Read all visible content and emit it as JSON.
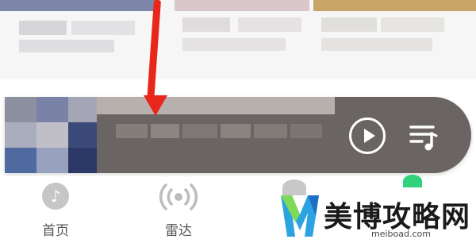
{
  "tabbar": {
    "home_label": "首页",
    "radar_label": "雷达"
  },
  "mini_player": {
    "play_icon": "play-icon",
    "playlist_icon": "playlist-icon"
  },
  "watermark": {
    "name": "美博攻略网",
    "url": "meiboad.com"
  },
  "colors": {
    "annotation_arrow": "#e8261c",
    "player_bg": "#6a6462",
    "accent_green": "#32d27a"
  }
}
